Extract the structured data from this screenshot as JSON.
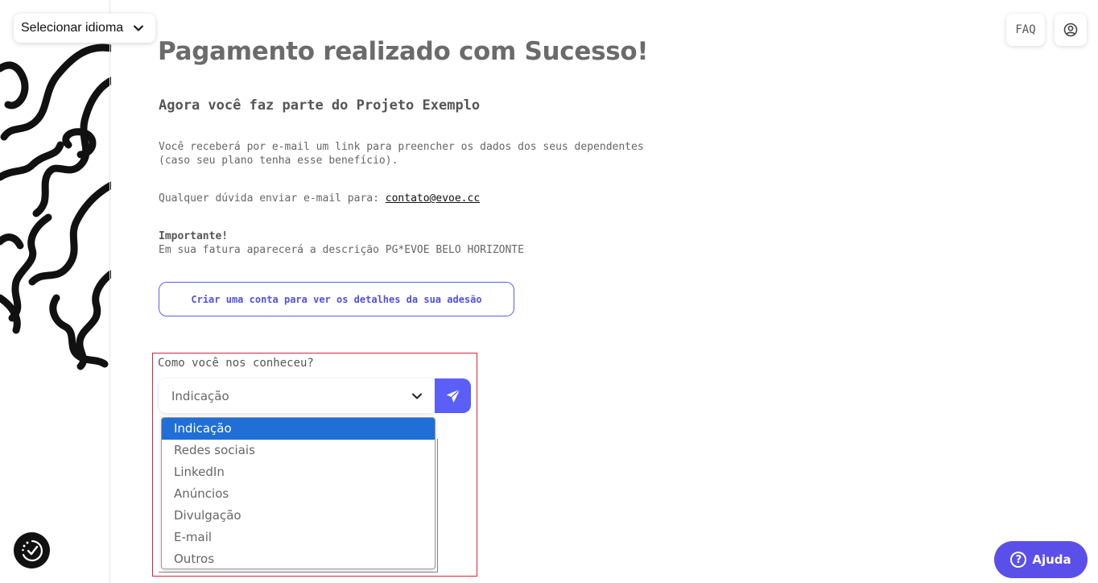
{
  "language_selector": {
    "label": "Selecionar idioma"
  },
  "header": {
    "faq_label": "FAQ"
  },
  "main": {
    "title": "Pagamento realizado com Sucesso!",
    "subtitle": "Agora você faz parte do Projeto Exemplo",
    "email_notice_line1": "Você receberá por e-mail um link para preencher os dados dos seus dependentes",
    "email_notice_line2": "(caso seu plano tenha esse benefício).",
    "contact_prefix": "Qualquer dúvida enviar e-mail para: ",
    "contact_email": "contato@evoe.cc",
    "important_label": "Importante!",
    "important_text": "Em sua fatura aparecerá a descrição PG*EVOE BELO HORIZONTE",
    "create_account_button": "Criar uma conta para ver os detalhes da sua adesão"
  },
  "survey": {
    "question": "Como você nos conheceu?",
    "selected_value": "Indicação",
    "options": [
      "Indicação",
      "Redes sociais",
      "LinkedIn",
      "Anúncios",
      "Divulgação",
      "E-mail",
      "Outros"
    ],
    "highlighted_option": "Indicação"
  },
  "help_button": {
    "label": "Ajuda"
  },
  "colors": {
    "accent": "#5b5ef7",
    "help_accent": "#5b4fea",
    "dropdown_highlight": "#1f6fd6",
    "survey_outline": "#d9253a"
  },
  "icons": {
    "language_chevron": "chevron-down-icon",
    "user": "user-circle-icon",
    "send": "paper-plane-icon",
    "accessibility": "accessibility-icon",
    "help": "question-circle-icon"
  }
}
